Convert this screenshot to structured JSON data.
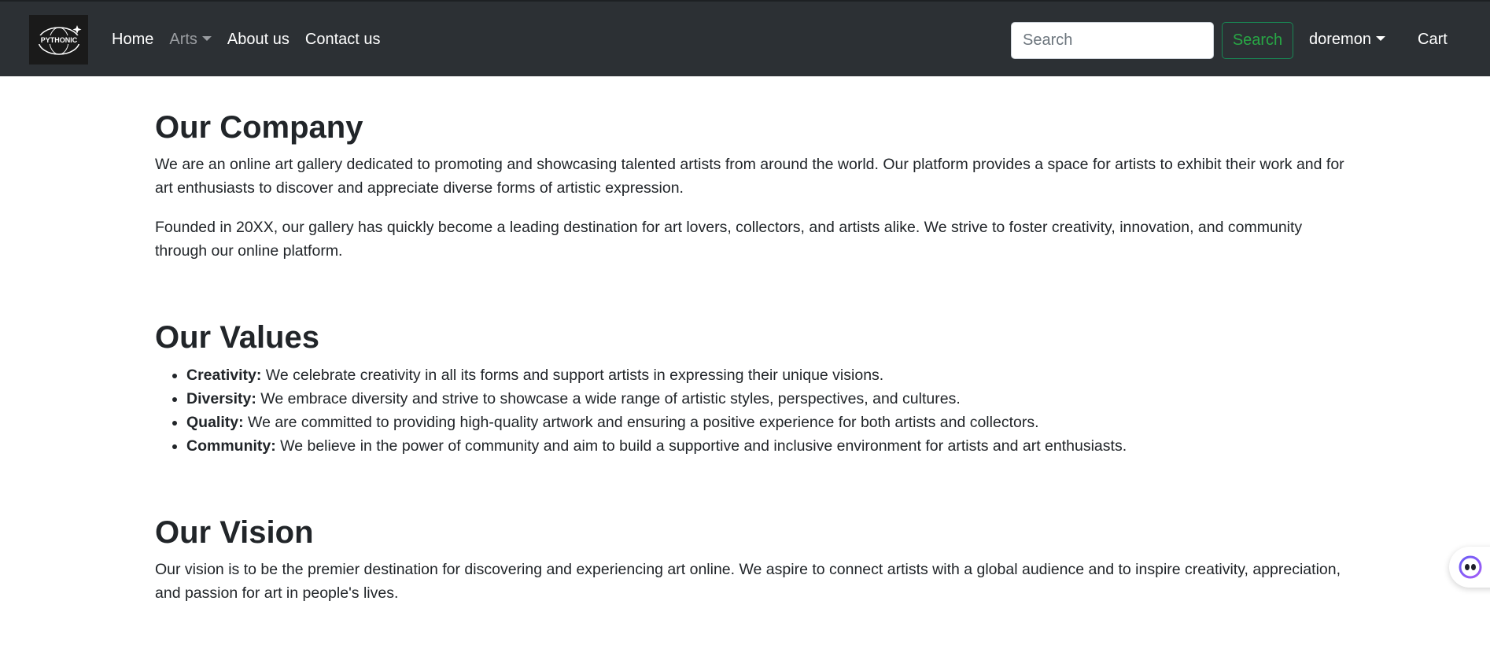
{
  "nav": {
    "logo_name": "pythonic-logo",
    "links": [
      "Home",
      "Arts",
      "About us",
      "Contact us"
    ],
    "search_placeholder": "Search",
    "search_button": "Search",
    "user": "doremon",
    "cart": "Cart"
  },
  "sections": {
    "company": {
      "title": "Our Company",
      "p1": "We are an online art gallery dedicated to promoting and showcasing talented artists from around the world. Our platform provides a space for artists to exhibit their work and for art enthusiasts to discover and appreciate diverse forms of artistic expression.",
      "p2": "Founded in 20XX, our gallery has quickly become a leading destination for art lovers, collectors, and artists alike. We strive to foster creativity, innovation, and community through our online platform."
    },
    "values": {
      "title": "Our Values",
      "items": [
        {
          "label": "Creativity:",
          "text": " We celebrate creativity in all its forms and support artists in expressing their unique visions."
        },
        {
          "label": "Diversity:",
          "text": " We embrace diversity and strive to showcase a wide range of artistic styles, perspectives, and cultures."
        },
        {
          "label": "Quality:",
          "text": " We are committed to providing high-quality artwork and ensuring a positive experience for both artists and collectors."
        },
        {
          "label": "Community:",
          "text": " We believe in the power of community and aim to build a supportive and inclusive environment for artists and art enthusiasts."
        }
      ]
    },
    "vision": {
      "title": "Our Vision",
      "p": "Our vision is to be the premier destination for discovering and experiencing art online. We aspire to connect artists with a global audience and to inspire creativity, appreciation, and passion for art in people's lives."
    }
  },
  "colors": {
    "navbar": "#2c3034",
    "search_button_border": "#198754",
    "search_button_text": "#28a745",
    "text": "#212529"
  },
  "chat_widget_icon": "assistant-face-icon"
}
